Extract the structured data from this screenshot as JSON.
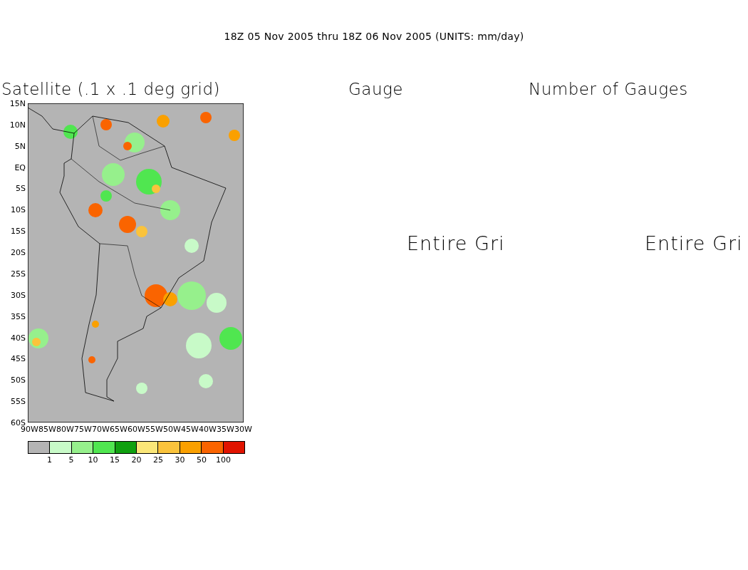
{
  "title": "18Z 05 Nov 2005 thru 18Z 06 Nov 2005 (UNITS: mm/day)",
  "panels": [
    {
      "title": "Satellite (.1 x .1 deg grid)",
      "kind": "map"
    },
    {
      "title": "Gauge",
      "kind": "text",
      "message": "Entire Gri"
    },
    {
      "title": "Number of Gauges",
      "kind": "text",
      "message": "Entire Gri"
    }
  ],
  "map": {
    "lat_labels": [
      "15N",
      "10N",
      "5N",
      "EQ",
      "5S",
      "10S",
      "15S",
      "20S",
      "25S",
      "30S",
      "35S",
      "40S",
      "45S",
      "50S",
      "55S",
      "60S"
    ],
    "lon_labels": [
      "90W",
      "85W",
      "80W",
      "75W",
      "70W",
      "65W",
      "60W",
      "55W",
      "50W",
      "45W",
      "40W",
      "35W",
      "30W"
    ]
  },
  "colorbar": {
    "bins": [
      {
        "color": "#b4b4b4"
      },
      {
        "color": "#c8fac8"
      },
      {
        "color": "#96f08c"
      },
      {
        "color": "#50e650"
      },
      {
        "color": "#0fa00f"
      },
      {
        "color": "#fae678"
      },
      {
        "color": "#fac33c"
      },
      {
        "color": "#faa000"
      },
      {
        "color": "#fa6400"
      },
      {
        "color": "#e11400"
      }
    ],
    "labels": [
      "1",
      "5",
      "10",
      "15",
      "20",
      "25",
      "30",
      "50",
      "100"
    ]
  }
}
